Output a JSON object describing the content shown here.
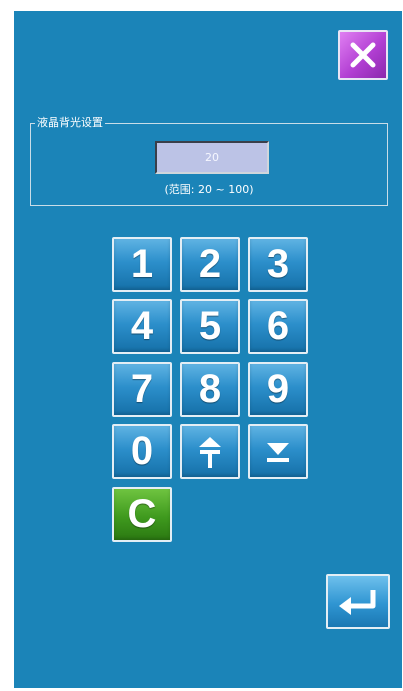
{
  "setting": {
    "title": "液晶背光设置",
    "value": "20",
    "range_text": "(范围: 20 ~ 100)"
  },
  "keypad": {
    "keys": [
      "1",
      "2",
      "3",
      "4",
      "5",
      "6",
      "7",
      "8",
      "9",
      "0"
    ],
    "clear_label": "C"
  },
  "icons": {
    "close": "close-icon",
    "increment": "up-arrow-icon",
    "decrement": "down-arrow-icon",
    "enter": "enter-icon"
  },
  "colors": {
    "background": "#1b84b8",
    "close_button": "#b23fd3",
    "clear_button": "#3f9a1e",
    "key": "#2c8fcb"
  }
}
